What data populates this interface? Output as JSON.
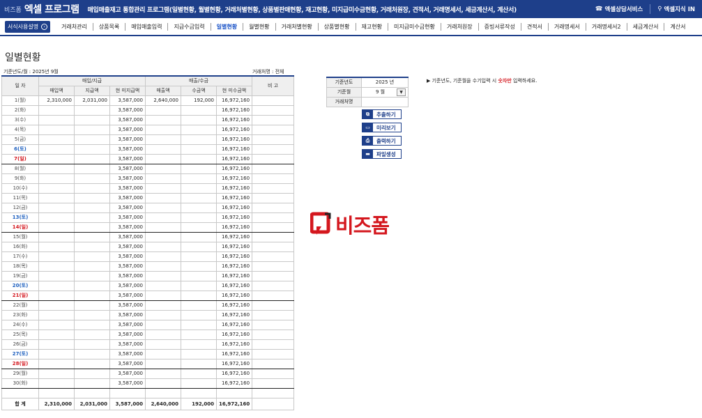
{
  "header": {
    "brand_small": "비즈폼",
    "brand_title": "엑셀 프로그램",
    "description": "매입매출재고 통합관리 프로그램(일별현황, 월별현황, 거래처별현황, 상품별판매현황, 재고현황, 미지급미수금현황, 거래처원장, 견적서, 거래명세서, 세금계산서, 계산서)",
    "links": [
      {
        "icon": "phone-icon",
        "glyph": "📞",
        "label": "엑셀상담서비스"
      },
      {
        "icon": "location-pin-icon",
        "glyph": "⚲",
        "label": "엑셀지식 IN"
      }
    ]
  },
  "nav": {
    "guide_label": "서식사용설명",
    "items": [
      "거래처관리",
      "상품목록",
      "매입매출입력",
      "지급수금입력",
      "일별현황",
      "월별현황",
      "거래처별현황",
      "상품별현황",
      "재고현황",
      "미지급미수금현황",
      "거래처원장",
      "증빙서류작성",
      "견적서",
      "거래명세서",
      "거래명세서2",
      "세금계산서",
      "계산서"
    ],
    "active_index": 4
  },
  "page": {
    "title": "일별현황",
    "meta_left": "기준년도/월 : 2025년 9월",
    "meta_right": "거래처명 : 전체"
  },
  "table": {
    "header_row1": {
      "date": "일 자",
      "purchase": "매입/지급",
      "sales": "매출/수금",
      "note": "비 고"
    },
    "header_row2": [
      "매입액",
      "지급액",
      "현 미지급액",
      "매출액",
      "수금액",
      "현 미수금액"
    ],
    "rows": [
      {
        "day": "1(월)",
        "type": "weekday",
        "cols": [
          "2,310,000",
          "2,031,000",
          "3,587,000",
          "2,640,000",
          "192,000",
          "16,972,160"
        ]
      },
      {
        "day": "2(화)",
        "type": "weekday",
        "cols": [
          "",
          "",
          "3,587,000",
          "",
          "",
          "16,972,160"
        ]
      },
      {
        "day": "3(수)",
        "type": "weekday",
        "cols": [
          "",
          "",
          "3,587,000",
          "",
          "",
          "16,972,160"
        ]
      },
      {
        "day": "4(목)",
        "type": "weekday",
        "cols": [
          "",
          "",
          "3,587,000",
          "",
          "",
          "16,972,160"
        ]
      },
      {
        "day": "5(금)",
        "type": "weekday",
        "cols": [
          "",
          "",
          "3,587,000",
          "",
          "",
          "16,972,160"
        ]
      },
      {
        "day": "6(토)",
        "type": "sat",
        "cols": [
          "",
          "",
          "3,587,000",
          "",
          "",
          "16,972,160"
        ]
      },
      {
        "day": "7(일)",
        "type": "sun",
        "cols": [
          "",
          "",
          "3,587,000",
          "",
          "",
          "16,972,160"
        ]
      },
      {
        "day": "8(월)",
        "type": "weekday",
        "cols": [
          "",
          "",
          "3,587,000",
          "",
          "",
          "16,972,160"
        ]
      },
      {
        "day": "9(화)",
        "type": "weekday",
        "cols": [
          "",
          "",
          "3,587,000",
          "",
          "",
          "16,972,160"
        ]
      },
      {
        "day": "10(수)",
        "type": "weekday",
        "cols": [
          "",
          "",
          "3,587,000",
          "",
          "",
          "16,972,160"
        ]
      },
      {
        "day": "11(목)",
        "type": "weekday",
        "cols": [
          "",
          "",
          "3,587,000",
          "",
          "",
          "16,972,160"
        ]
      },
      {
        "day": "12(금)",
        "type": "weekday",
        "cols": [
          "",
          "",
          "3,587,000",
          "",
          "",
          "16,972,160"
        ]
      },
      {
        "day": "13(토)",
        "type": "sat",
        "cols": [
          "",
          "",
          "3,587,000",
          "",
          "",
          "16,972,160"
        ]
      },
      {
        "day": "14(일)",
        "type": "sun",
        "cols": [
          "",
          "",
          "3,587,000",
          "",
          "",
          "16,972,160"
        ]
      },
      {
        "day": "15(월)",
        "type": "weekday",
        "cols": [
          "",
          "",
          "3,587,000",
          "",
          "",
          "16,972,160"
        ]
      },
      {
        "day": "16(화)",
        "type": "weekday",
        "cols": [
          "",
          "",
          "3,587,000",
          "",
          "",
          "16,972,160"
        ]
      },
      {
        "day": "17(수)",
        "type": "weekday",
        "cols": [
          "",
          "",
          "3,587,000",
          "",
          "",
          "16,972,160"
        ]
      },
      {
        "day": "18(목)",
        "type": "weekday",
        "cols": [
          "",
          "",
          "3,587,000",
          "",
          "",
          "16,972,160"
        ]
      },
      {
        "day": "19(금)",
        "type": "weekday",
        "cols": [
          "",
          "",
          "3,587,000",
          "",
          "",
          "16,972,160"
        ]
      },
      {
        "day": "20(토)",
        "type": "sat",
        "cols": [
          "",
          "",
          "3,587,000",
          "",
          "",
          "16,972,160"
        ]
      },
      {
        "day": "21(일)",
        "type": "sun",
        "cols": [
          "",
          "",
          "3,587,000",
          "",
          "",
          "16,972,160"
        ]
      },
      {
        "day": "22(월)",
        "type": "weekday",
        "cols": [
          "",
          "",
          "3,587,000",
          "",
          "",
          "16,972,160"
        ]
      },
      {
        "day": "23(화)",
        "type": "weekday",
        "cols": [
          "",
          "",
          "3,587,000",
          "",
          "",
          "16,972,160"
        ]
      },
      {
        "day": "24(수)",
        "type": "weekday",
        "cols": [
          "",
          "",
          "3,587,000",
          "",
          "",
          "16,972,160"
        ]
      },
      {
        "day": "25(목)",
        "type": "weekday",
        "cols": [
          "",
          "",
          "3,587,000",
          "",
          "",
          "16,972,160"
        ]
      },
      {
        "day": "26(금)",
        "type": "weekday",
        "cols": [
          "",
          "",
          "3,587,000",
          "",
          "",
          "16,972,160"
        ]
      },
      {
        "day": "27(토)",
        "type": "sat",
        "cols": [
          "",
          "",
          "3,587,000",
          "",
          "",
          "16,972,160"
        ]
      },
      {
        "day": "28(일)",
        "type": "sun",
        "cols": [
          "",
          "",
          "3,587,000",
          "",
          "",
          "16,972,160"
        ]
      },
      {
        "day": "29(월)",
        "type": "weekday",
        "cols": [
          "",
          "",
          "3,587,000",
          "",
          "",
          "16,972,160"
        ]
      },
      {
        "day": "30(화)",
        "type": "weekday",
        "cols": [
          "",
          "",
          "3,587,000",
          "",
          "",
          "16,972,160"
        ]
      },
      {
        "day": "",
        "type": "blank",
        "cols": [
          "",
          "",
          "",
          "",
          "",
          ""
        ]
      }
    ],
    "total": {
      "label": "합 계",
      "cols": [
        "2,310,000",
        "2,031,000",
        "3,587,000",
        "2,640,000",
        "192,000",
        "16,972,160"
      ]
    }
  },
  "filter": {
    "year_label": "기준년도",
    "year_value": "2025 년",
    "month_label": "기준월",
    "month_value": "9 월",
    "client_label": "거래처명",
    "client_value": ""
  },
  "actions": [
    {
      "name": "extract-button",
      "icon": "copy-icon",
      "glyph": "⧉",
      "label": "추출하기"
    },
    {
      "name": "preview-button",
      "icon": "monitor-icon",
      "glyph": "▭",
      "label": "미리보기"
    },
    {
      "name": "print-button",
      "icon": "printer-icon",
      "glyph": "⎙",
      "label": "출력하기"
    },
    {
      "name": "file-create-button",
      "icon": "folder-icon",
      "glyph": "▬",
      "label": "파일생성"
    }
  ],
  "note": {
    "prefix": "▶ 기준년도, 기준월을 수기입력 시 ",
    "highlight": "숫자만",
    "suffix": " 입력하세요."
  },
  "logo": {
    "text": "비즈폼"
  },
  "colors": {
    "primary": "#1e3f8a",
    "saturday": "#1d5fbf",
    "sunday": "#d4171e",
    "accent_red": "#d4171e"
  }
}
